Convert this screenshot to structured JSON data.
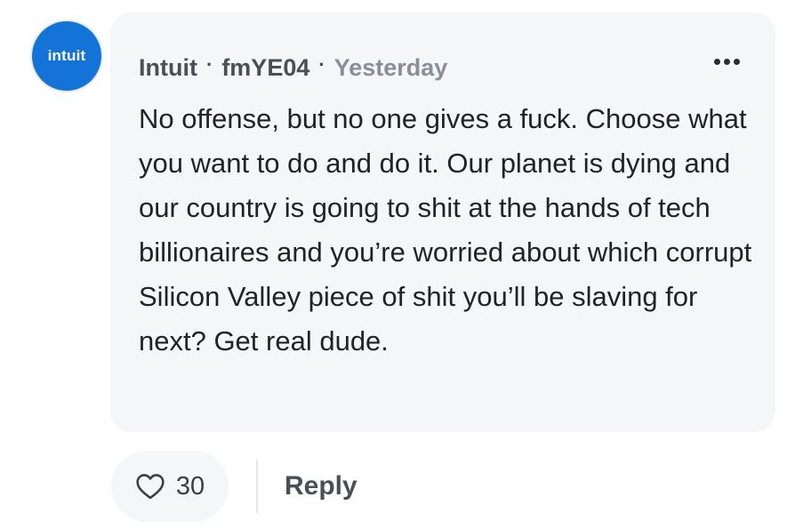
{
  "author": {
    "avatar_text": "intuit",
    "avatar_color": "#1473d6",
    "company": "Intuit",
    "username": "fmYE04",
    "timestamp": "Yesterday"
  },
  "comment": {
    "text": "No offense, but no one gives a fuck. Choose what you want to do and do it. Our planet is dying and our country is going to shit at the hands of tech billionaires and you’re worried about which corrupt Silicon Valley piece of shit you’ll be slaving for next? Get real dude."
  },
  "meta": {
    "separator": "·"
  },
  "menu": {
    "icon": "more-horizontal-icon"
  },
  "actions": {
    "like_icon": "heart-icon",
    "like_count": "30",
    "reply_label": "Reply"
  }
}
